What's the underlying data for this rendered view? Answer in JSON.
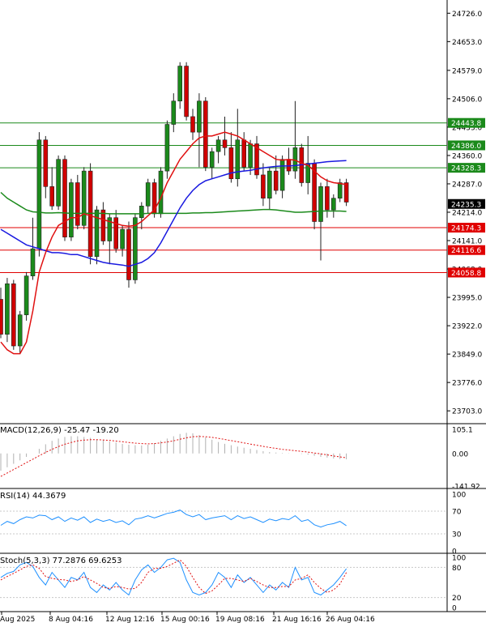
{
  "chart_data": {
    "type": "candlestick",
    "price_ticks": [
      "24726.0",
      "24653.0",
      "24579.0",
      "24506.0",
      "24433.0",
      "24360.0",
      "24287.0",
      "24214.0",
      "24141.0",
      "24068.0",
      "23995.0",
      "23922.0",
      "23849.0",
      "23776.0",
      "23703.0"
    ],
    "x_ticks": [
      "Aug 2025",
      "8 Aug 04:16",
      "12 Aug 12:16",
      "15 Aug 00:16",
      "19 Aug 08:16",
      "21 Aug 16:16",
      "26 Aug 04:16"
    ],
    "levels": [
      {
        "value": 24443.8,
        "label": "24443.8",
        "color": "#1b8a1b"
      },
      {
        "value": 24386.0,
        "label": "24386.0",
        "color": "#1b8a1b"
      },
      {
        "value": 24328.3,
        "label": "24328.3",
        "color": "#1b8a1b"
      },
      {
        "value": 24174.3,
        "label": "24174.3",
        "color": "#e00000"
      },
      {
        "value": 24116.6,
        "label": "24116.6",
        "color": "#e00000"
      },
      {
        "value": 24058.8,
        "label": "24058.8",
        "color": "#e00000"
      }
    ],
    "current_price": {
      "value": 24235.3,
      "label": "24235.3"
    },
    "candles": [
      [
        23990,
        24020,
        23890,
        23900
      ],
      [
        23900,
        24045,
        23880,
        24030
      ],
      [
        24030,
        24040,
        23860,
        23870
      ],
      [
        23870,
        23960,
        23850,
        23950
      ],
      [
        23950,
        24060,
        23935,
        24050
      ],
      [
        24050,
        24200,
        24040,
        24120
      ],
      [
        24120,
        24420,
        24100,
        24400
      ],
      [
        24400,
        24410,
        24250,
        24280
      ],
      [
        24280,
        24330,
        24220,
        24230
      ],
      [
        24230,
        24360,
        24220,
        24350
      ],
      [
        24350,
        24360,
        24140,
        24150
      ],
      [
        24150,
        24300,
        24140,
        24290
      ],
      [
        24290,
        24310,
        24170,
        24180
      ],
      [
        24180,
        24330,
        24170,
        24320
      ],
      [
        24320,
        24340,
        24080,
        24100
      ],
      [
        24100,
        24230,
        24080,
        24220
      ],
      [
        24220,
        24240,
        24130,
        24140
      ],
      [
        24140,
        24210,
        24080,
        24200
      ],
      [
        24200,
        24220,
        24110,
        24120
      ],
      [
        24120,
        24180,
        24100,
        24170
      ],
      [
        24170,
        24190,
        24020,
        24040
      ],
      [
        24040,
        24210,
        24030,
        24200
      ],
      [
        24200,
        24240,
        24170,
        24230
      ],
      [
        24230,
        24300,
        24210,
        24290
      ],
      [
        24290,
        24300,
        24200,
        24210
      ],
      [
        24210,
        24330,
        24200,
        24320
      ],
      [
        24320,
        24450,
        24300,
        24440
      ],
      [
        24440,
        24520,
        24420,
        24500
      ],
      [
        24500,
        24600,
        24480,
        24590
      ],
      [
        24590,
        24600,
        24450,
        24460
      ],
      [
        24460,
        24480,
        24400,
        24420
      ],
      [
        24420,
        24520,
        24330,
        24500
      ],
      [
        24500,
        24510,
        24320,
        24330
      ],
      [
        24330,
        24380,
        24300,
        24370
      ],
      [
        24370,
        24410,
        24340,
        24400
      ],
      [
        24400,
        24460,
        24360,
        24380
      ],
      [
        24380,
        24420,
        24290,
        24300
      ],
      [
        24300,
        24480,
        24280,
        24400
      ],
      [
        24400,
        24420,
        24320,
        24330
      ],
      [
        24330,
        24400,
        24310,
        24390
      ],
      [
        24390,
        24410,
        24300,
        24310
      ],
      [
        24310,
        24340,
        24230,
        24250
      ],
      [
        24250,
        24330,
        24220,
        24320
      ],
      [
        24320,
        24360,
        24260,
        24270
      ],
      [
        24270,
        24360,
        24250,
        24350
      ],
      [
        24350,
        24380,
        24310,
        24320
      ],
      [
        24320,
        24500,
        24300,
        24380
      ],
      [
        24380,
        24390,
        24280,
        24290
      ],
      [
        24290,
        24410,
        24260,
        24340
      ],
      [
        24340,
        24350,
        24170,
        24190
      ],
      [
        24190,
        24290,
        24090,
        24280
      ],
      [
        24280,
        24300,
        24200,
        24220
      ],
      [
        24220,
        24260,
        24200,
        24250
      ],
      [
        24250,
        24300,
        24240,
        24290
      ],
      [
        24290,
        24300,
        24230,
        24240
      ]
    ],
    "ma_red": [
      23880,
      23860,
      23850,
      23850,
      23880,
      23960,
      24060,
      24110,
      24150,
      24180,
      24190,
      24200,
      24200,
      24210,
      24205,
      24200,
      24195,
      24190,
      24185,
      24180,
      24178,
      24180,
      24190,
      24205,
      24220,
      24250,
      24290,
      24320,
      24350,
      24370,
      24390,
      24405,
      24410,
      24410,
      24415,
      24420,
      24415,
      24410,
      24400,
      24390,
      24380,
      24370,
      24360,
      24350,
      24348,
      24350,
      24348,
      24340,
      24335,
      24320,
      24305,
      24295,
      24290,
      24288,
      24285
    ],
    "ma_blue": [
      24170,
      24160,
      24150,
      24140,
      24130,
      24125,
      24120,
      24115,
      24110,
      24110,
      24108,
      24105,
      24105,
      24100,
      24095,
      24090,
      24085,
      24082,
      24080,
      24078,
      24075,
      24080,
      24085,
      24095,
      24110,
      24135,
      24165,
      24195,
      24225,
      24250,
      24270,
      24285,
      24295,
      24300,
      24305,
      24310,
      24315,
      24318,
      24320,
      24322,
      24325,
      24328,
      24330,
      24332,
      24333,
      24333,
      24334,
      24336,
      24338,
      24340,
      24342,
      24344,
      24345,
      24346,
      24347
    ],
    "ma_green": [
      24265,
      24250,
      24240,
      24230,
      24220,
      24215,
      24214,
      24212,
      24212,
      24213,
      24212,
      24211,
      24211,
      24211,
      24211,
      24211,
      24211,
      24210,
      24210,
      24210,
      24210,
      24210,
      24210,
      24211,
      24211,
      24211,
      24211,
      24211,
      24211,
      24211,
      24212,
      24212,
      24213,
      24213,
      24214,
      24215,
      24216,
      24217,
      24218,
      24219,
      24220,
      24221,
      24221,
      24220,
      24218,
      24216,
      24214,
      24214,
      24215,
      24216,
      24217,
      24217,
      24217,
      24217,
      24216
    ],
    "macd": {
      "label": "MACD(12,26,9) -25.47 -19.20",
      "ticks": [
        "105.1",
        "0.00",
        "-141.92"
      ],
      "range": [
        -141.92,
        105.1
      ],
      "hist": [
        -75,
        -60,
        -45,
        -30,
        -15,
        0,
        20,
        40,
        55,
        65,
        72,
        75,
        75,
        72,
        68,
        62,
        58,
        52,
        48,
        42,
        38,
        36,
        35,
        38,
        45,
        55,
        65,
        75,
        85,
        90,
        88,
        80,
        70,
        60,
        50,
        42,
        36,
        30,
        25,
        20,
        15,
        10,
        6,
        4,
        2,
        1,
        0,
        -2,
        -5,
        -10,
        -15,
        -18,
        -22,
        -24,
        -25.47
      ],
      "signal": [
        -100,
        -85,
        -70,
        -55,
        -40,
        -25,
        -10,
        5,
        18,
        30,
        40,
        48,
        55,
        58,
        60,
        60,
        59,
        57,
        54,
        51,
        48,
        45,
        43,
        42,
        43,
        46,
        50,
        55,
        62,
        68,
        73,
        74,
        73,
        70,
        66,
        61,
        56,
        51,
        46,
        41,
        36,
        31,
        26,
        22,
        18,
        15,
        12,
        9,
        6,
        2,
        -2,
        -6,
        -11,
        -15,
        -19.2
      ]
    },
    "rsi": {
      "label": "RSI(14) 44.3679",
      "ticks": [
        "100",
        "70",
        "30",
        "0"
      ],
      "range": [
        0,
        100
      ],
      "values": [
        45,
        52,
        48,
        55,
        60,
        58,
        63,
        62,
        55,
        60,
        52,
        58,
        54,
        60,
        50,
        56,
        52,
        55,
        50,
        53,
        46,
        56,
        58,
        62,
        58,
        62,
        66,
        68,
        72,
        64,
        60,
        64,
        55,
        58,
        60,
        62,
        55,
        62,
        57,
        60,
        55,
        50,
        56,
        53,
        57,
        55,
        62,
        52,
        55,
        46,
        42,
        46,
        48,
        52,
        44.3679
      ]
    },
    "stoch": {
      "label": "Stoch(5,3,3) 77.2876 69.6253",
      "ticks": [
        "100",
        "80",
        "20",
        "0"
      ],
      "range": [
        0,
        100
      ],
      "k": [
        60,
        68,
        72,
        85,
        90,
        82,
        60,
        45,
        70,
        55,
        40,
        60,
        55,
        70,
        40,
        30,
        45,
        35,
        50,
        35,
        25,
        55,
        75,
        85,
        70,
        80,
        95,
        98,
        90,
        55,
        30,
        25,
        30,
        45,
        70,
        60,
        40,
        65,
        50,
        60,
        45,
        30,
        45,
        35,
        50,
        40,
        80,
        55,
        60,
        30,
        25,
        35,
        45,
        60,
        77.2876
      ],
      "d": [
        55,
        62,
        68,
        75,
        82,
        85,
        78,
        62,
        58,
        56,
        55,
        52,
        55,
        62,
        55,
        48,
        40,
        38,
        42,
        40,
        37,
        38,
        50,
        70,
        78,
        78,
        82,
        88,
        95,
        82,
        60,
        40,
        28,
        33,
        45,
        58,
        58,
        55,
        52,
        58,
        52,
        45,
        40,
        40,
        42,
        42,
        55,
        58,
        65,
        50,
        38,
        30,
        35,
        47,
        69.6253
      ]
    }
  }
}
